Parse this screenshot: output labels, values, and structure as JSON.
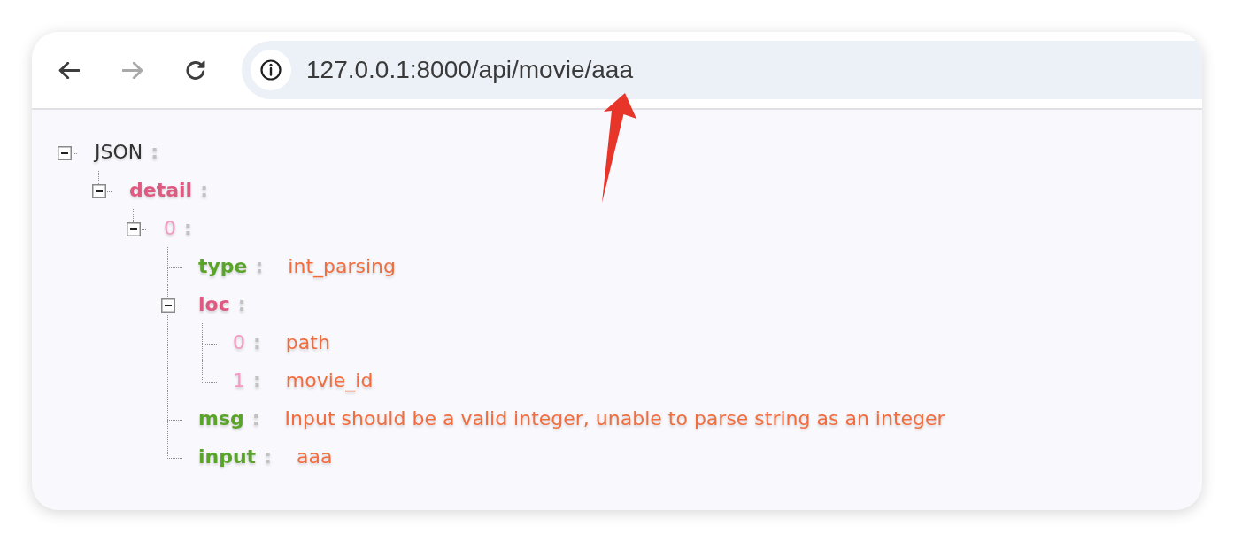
{
  "toolbar": {
    "nav_buttons": [
      {
        "kind": "back",
        "disabled": false
      },
      {
        "kind": "forward",
        "disabled": true
      },
      {
        "kind": "reload",
        "disabled": false
      }
    ],
    "address_bar": {
      "url": "127.0.0.1:8000/api/movie/aaa"
    }
  },
  "tree": {
    "key": "JSON",
    "kind": "root",
    "sep": ":",
    "expanded": true,
    "children": [
      {
        "key": "detail",
        "kind": "array",
        "sep": ":",
        "expanded": true,
        "children": [
          {
            "key": "0",
            "kind": "index",
            "sep": ":",
            "expanded": true,
            "children": [
              {
                "key": "type",
                "kind": "field",
                "sep": ":",
                "value": "int_parsing"
              },
              {
                "key": "loc",
                "kind": "array",
                "sep": ":",
                "expanded": true,
                "children": [
                  {
                    "key": "0",
                    "kind": "index",
                    "sep": ":",
                    "value": "path"
                  },
                  {
                    "key": "1",
                    "kind": "index",
                    "sep": ":",
                    "value": "movie_id"
                  }
                ]
              },
              {
                "key": "msg",
                "kind": "field",
                "sep": ":",
                "value": "Input should be a valid integer, unable to parse string as an integer"
              },
              {
                "key": "input",
                "kind": "field",
                "sep": ":",
                "value": "aaa"
              }
            ]
          }
        ]
      }
    ]
  }
}
